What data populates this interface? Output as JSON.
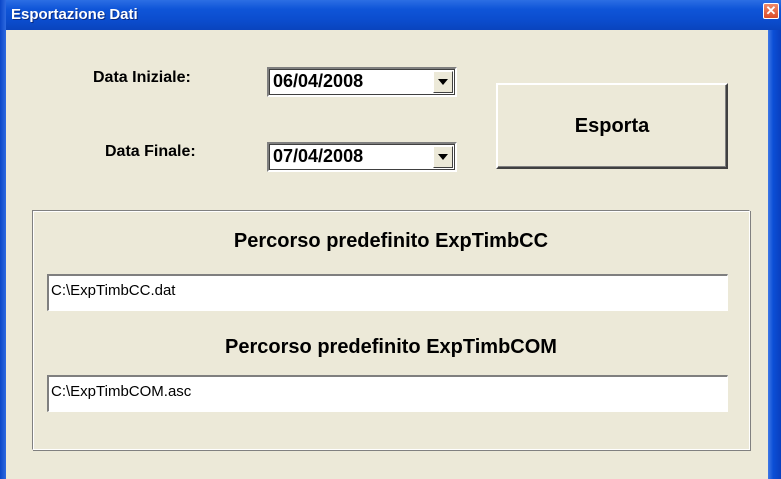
{
  "window": {
    "title": "Esportazione Dati",
    "close_glyph": "✕"
  },
  "dates": {
    "start_label": "Data Iniziale:",
    "start_value": "06/04/2008",
    "end_label": "Data Finale:",
    "end_value": "07/04/2008"
  },
  "actions": {
    "export_label": "Esporta"
  },
  "paths": {
    "cc_title": "Percorso predefinito ExpTimbCC",
    "cc_value": "C:\\ExpTimbCC.dat",
    "com_title": "Percorso predefinito ExpTimbCOM",
    "com_value": "C:\\ExpTimbCOM.asc"
  },
  "colors": {
    "titlebar": "#0b4ccd",
    "window_bg": "#ece9d8",
    "close_button": "#d94c28"
  },
  "icons": {
    "close": "close-icon",
    "dropdown": "chevron-down-icon"
  }
}
